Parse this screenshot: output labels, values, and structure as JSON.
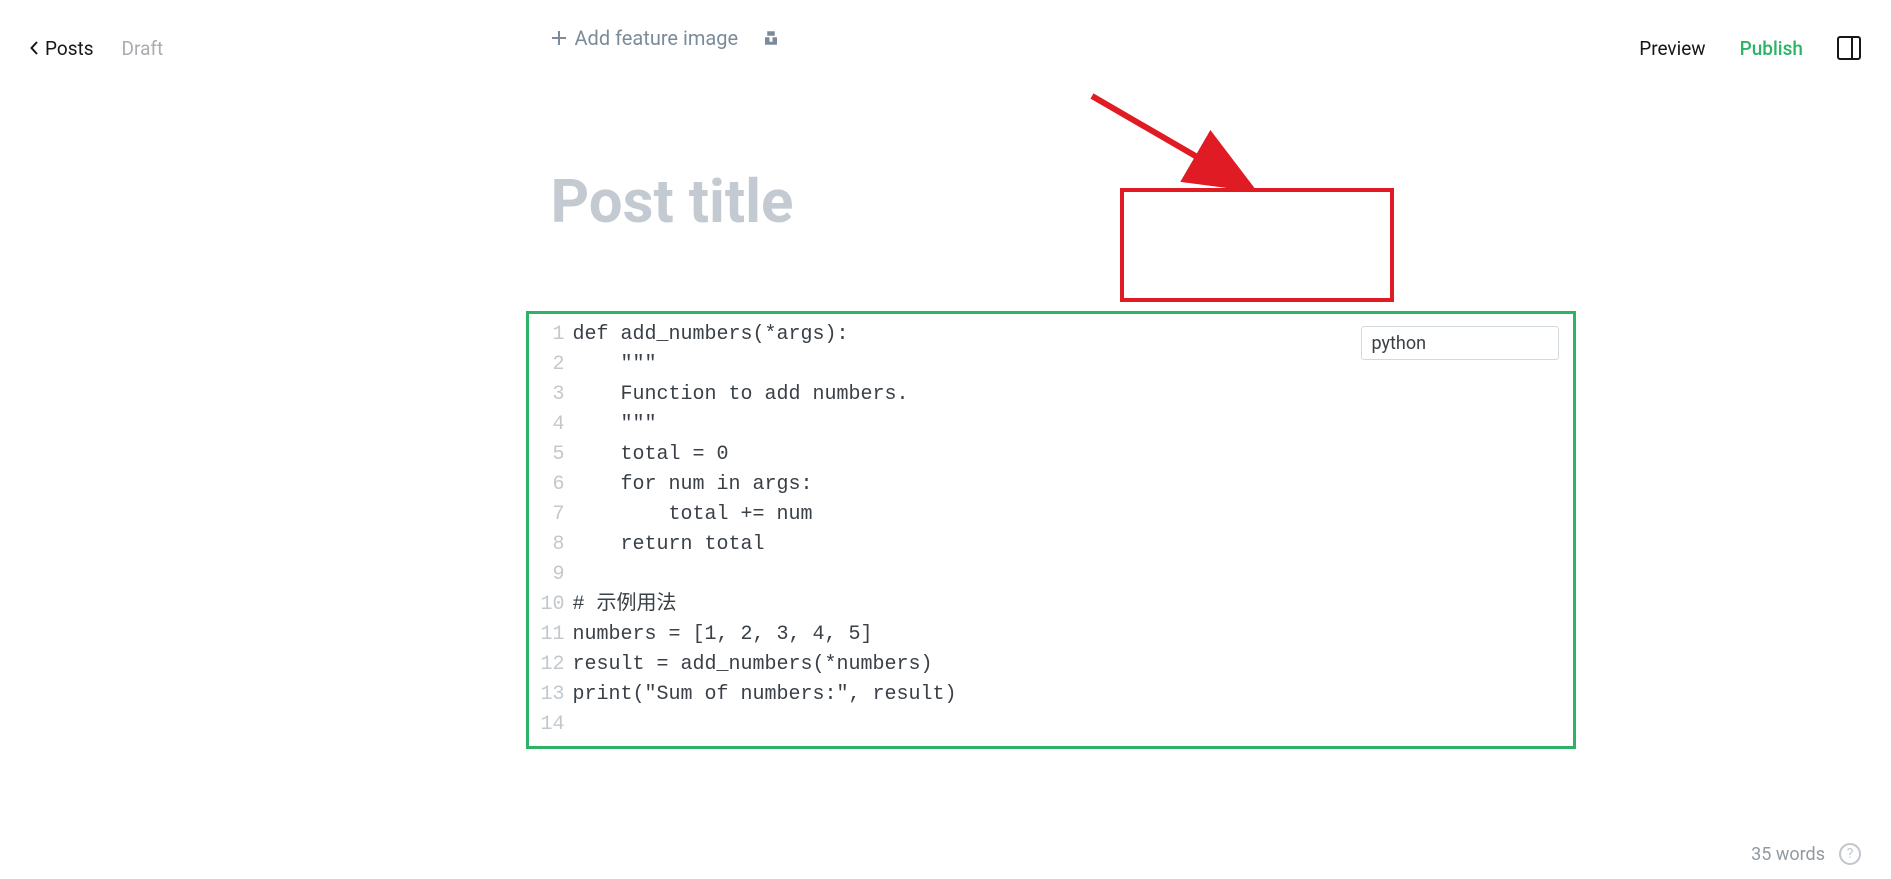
{
  "topbar": {
    "back_label": "Posts",
    "status_label": "Draft",
    "preview_label": "Preview",
    "publish_label": "Publish"
  },
  "feature": {
    "add_label": "Add feature image"
  },
  "title": {
    "placeholder": "Post title",
    "value": ""
  },
  "code_card": {
    "language_value": "python",
    "lines": [
      "def add_numbers(*args):",
      "    \"\"\"",
      "    Function to add numbers.",
      "    \"\"\"",
      "    total = 0",
      "    for num in args:",
      "        total += num",
      "    return total",
      "",
      "# 示例用法",
      "numbers = [1, 2, 3, 4, 5]",
      "result = add_numbers(*numbers)",
      "print(\"Sum of numbers:\", result)",
      ""
    ]
  },
  "footer": {
    "word_count": "35 words"
  }
}
